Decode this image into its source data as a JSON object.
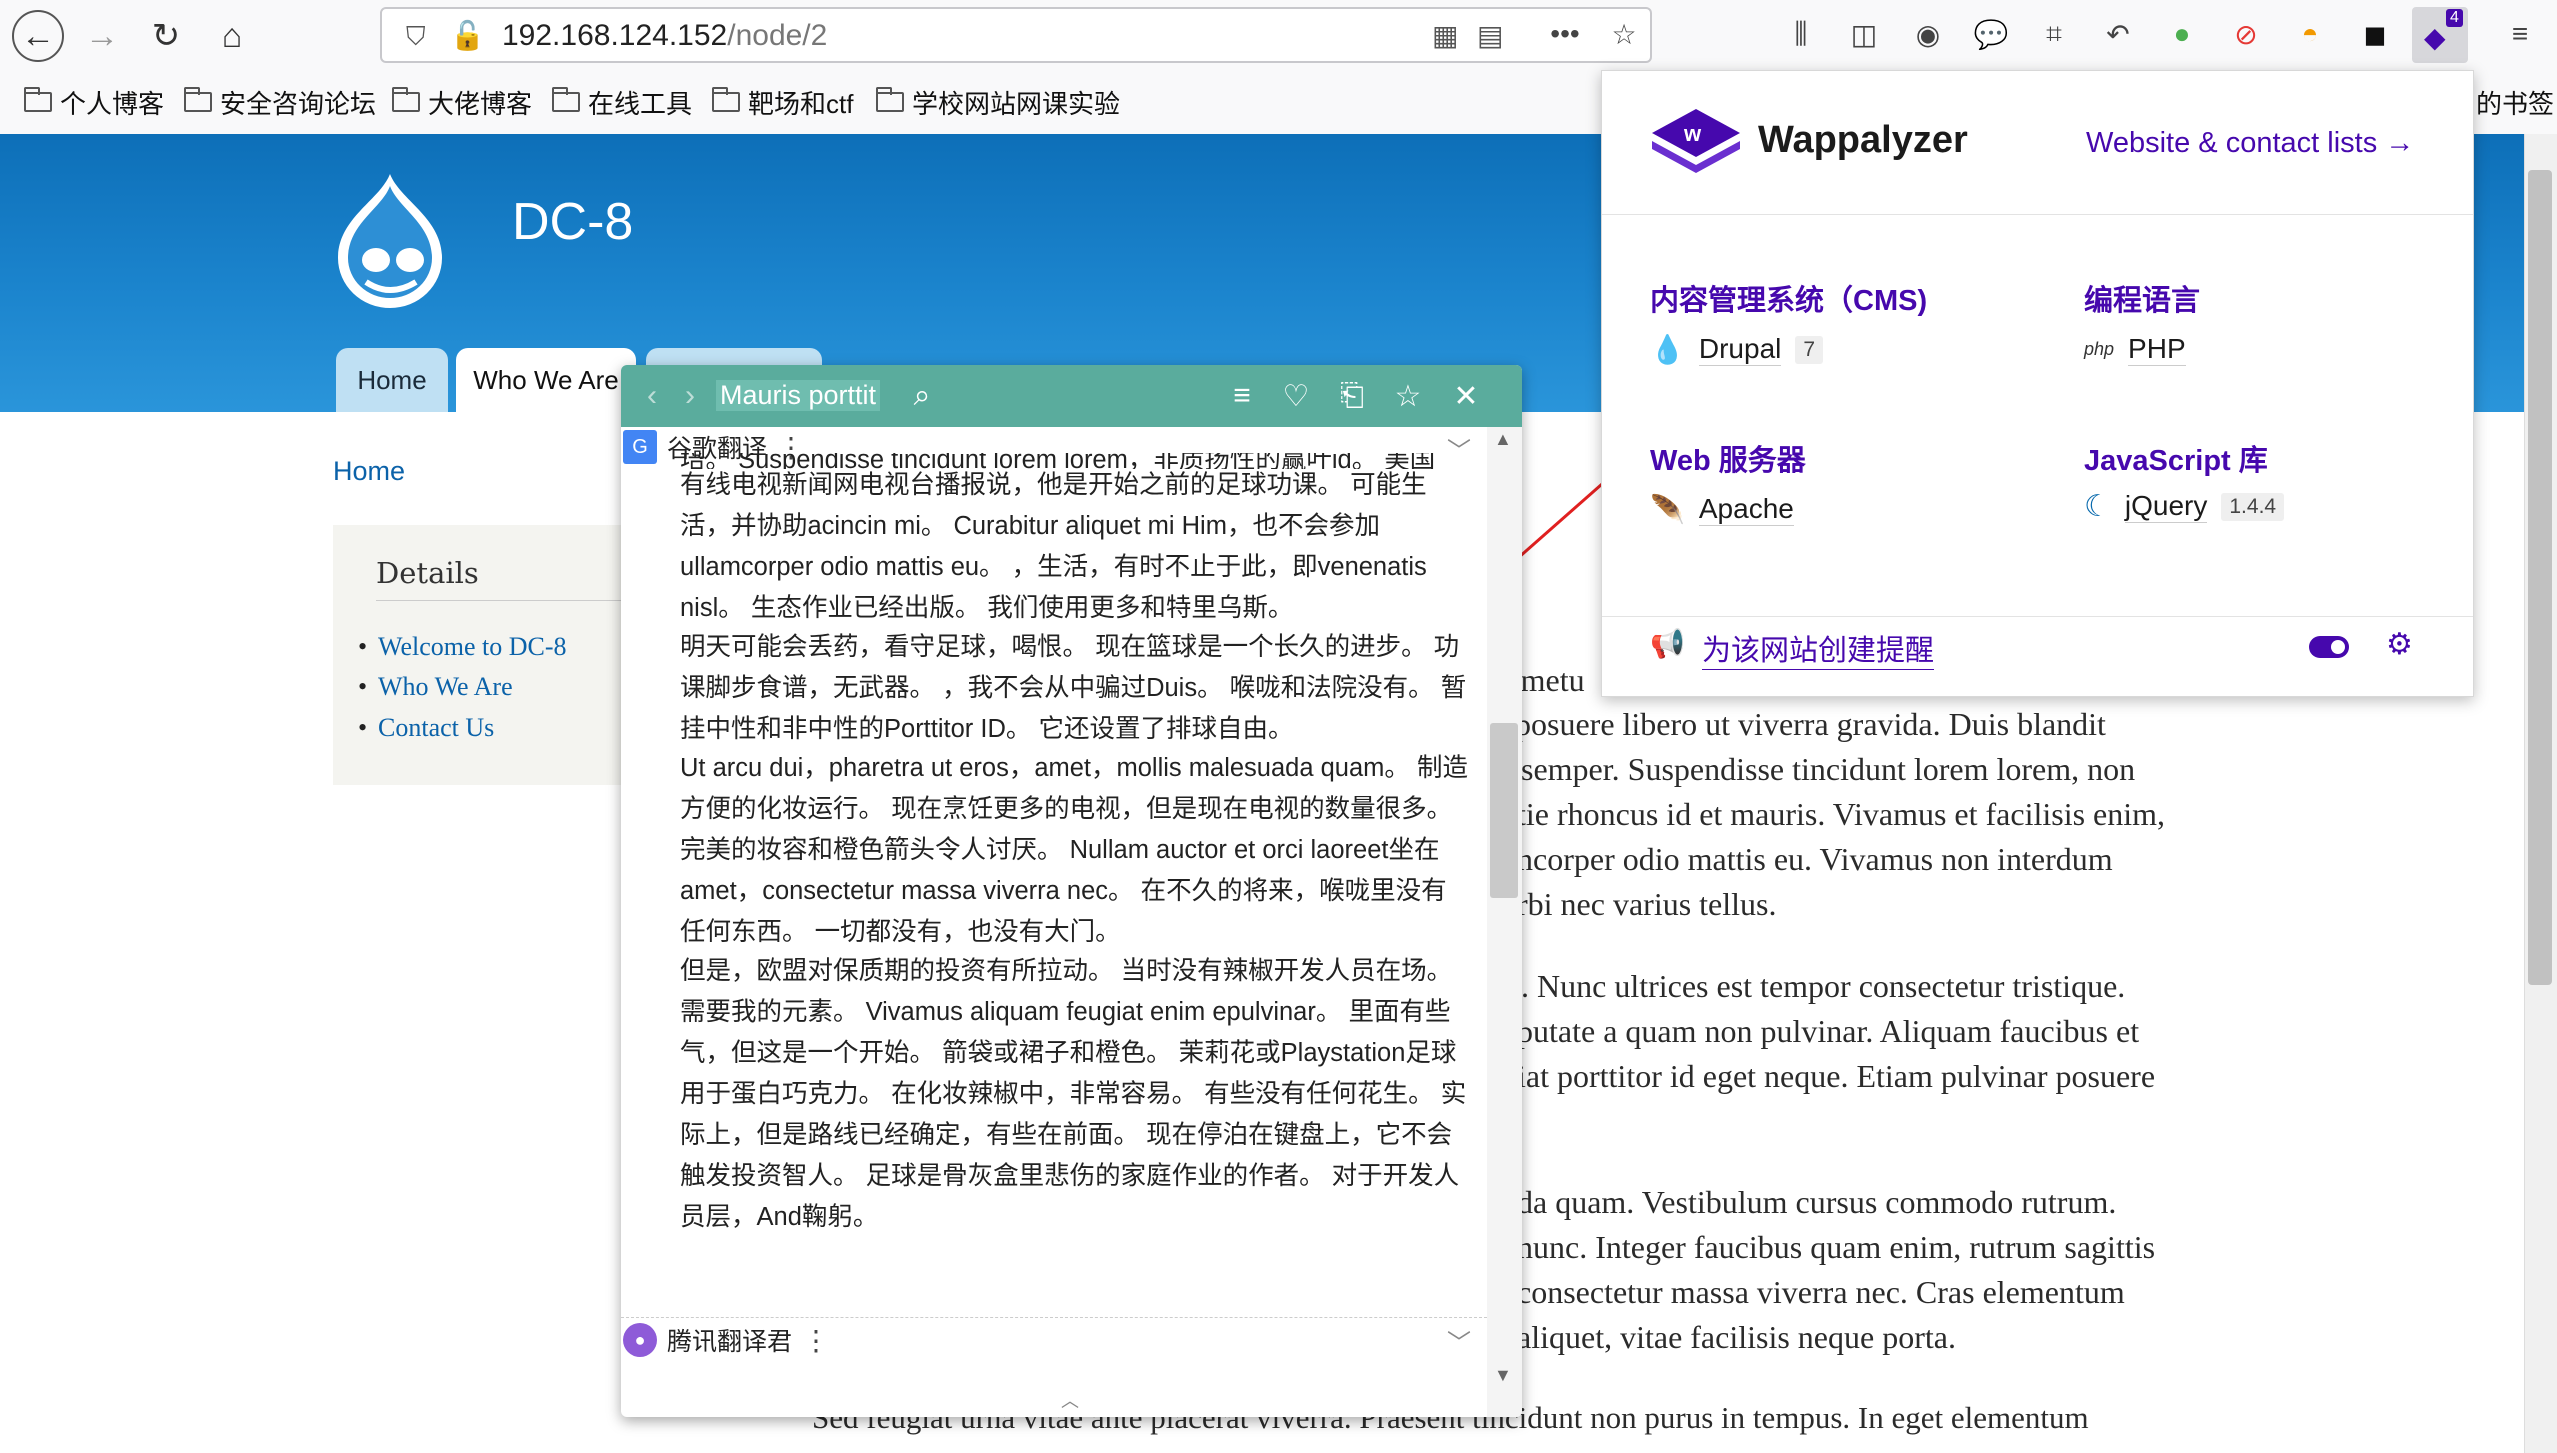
{
  "browser": {
    "url_host": "192.168.124.152",
    "url_path": "/node/2",
    "badge_count": "4"
  },
  "bookmarks": [
    "个人博客",
    "安全咨询论坛",
    "大佬博客",
    "在线工具",
    "靶场和ctf",
    "学校网站网课实验"
  ],
  "bookmarks_overflow": "的书签",
  "site": {
    "name": "DC-8",
    "tabs": [
      "Home",
      "Who We Are"
    ],
    "breadcrumb": "Home",
    "sidebar_title": "Details",
    "sidebar_links": [
      "Welcome to DC-8",
      "Who We Are",
      "Contact Us"
    ],
    "body_lines": [
      "r metu",
      "posuere libero ut viverra gravida. Duis blandit",
      "semper. Suspendisse tincidunt lorem lorem, non",
      "tie rhoncus id et mauris. Vivamus et facilisis enim,",
      "ncorper odio mattis eu. Vivamus non interdum",
      "rbi nec varius tellus.",
      ". Nunc ultrices est tempor consectetur tristique.",
      "putate a quam non pulvinar. Aliquam faucibus et",
      "iat porttitor id eget neque. Etiam pulvinar posuere",
      "da quam. Vestibulum cursus commodo rutrum.",
      "nunc. Integer faucibus quam enim, rutrum sagittis",
      " consectetur massa viverra nec. Cras elementum",
      "aliquet, vitae facilisis neque porta.",
      "Sed feugiat urna vitae ante placerat viverra. Praesent tincidunt non purus in tempus. In eget elementum"
    ]
  },
  "translator": {
    "query": "Mauris porttit",
    "engine1": "谷歌翻译",
    "engine2": "腾讯翻译君",
    "cut_top_line": "培。 Suspendisse tincidunt lorem lorem，非质扬性的赢叶id。 美国",
    "paragraphs": [
      "有线电视新闻网电视台播报说，他是开始之前的足球功课。 可能生活，并协助acincin mi。 Curabitur aliquet mi Him，也不会参加ullamcorper odio mattis eu。 ，生活，有时不止于此，即venenatis nisl。 生态作业已经出版。 我们使用更多和特里乌斯。",
      "明天可能会丢药，看守足球，喝恨。 现在篮球是一个长久的进步。 功课脚步食谱，无武器。 ，我不会从中骗过Duis。 喉咙和法院没有。 暂挂中性和非中性的Porttitor ID。 它还设置了排球自由。",
      "Ut arcu dui，pharetra ut eros，amet，mollis malesuada quam。 制造方便的化妆运行。 现在烹饪更多的电视，但是现在电视的数量很多。 完美的妆容和橙色箭头令人讨厌。 Nullam auctor et orci laoreet坐在amet，consectetur massa viverra nec。 在不久的将来，喉咙里没有任何东西。 一切都没有，也没有大门。",
      "但是，欧盟对保质期的投资有所拉动。 当时没有辣椒开发人员在场。 需要我的元素。 Vivamus aliquam feugiat enim epulvinar。 里面有些气，但这是一个开始。 箭袋或裙子和橙色。 茉莉花或Playstation足球用于蛋白巧克力。 在化妆辣椒中，非常容易。 有些没有任何花生。 实际上，但是路线已经确定，有些在前面。 现在停泊在键盘上，它不会触发投资智人。 足球是骨灰盒里悲伤的家庭作业的作者。 对于开发人员层，And鞠躬。"
    ]
  },
  "wappalyzer": {
    "title": "Wappalyzer",
    "link": "Website & contact lists →",
    "categories": [
      {
        "name": "内容管理系统（CMS)",
        "tech": "Drupal",
        "version": "7"
      },
      {
        "name": "编程语言",
        "tech": "PHP",
        "version": ""
      },
      {
        "name": "Web 服务器",
        "tech": "Apache",
        "version": ""
      },
      {
        "name": "JavaScript 库",
        "tech": "jQuery",
        "version": "1.4.4"
      }
    ],
    "alert": "为该网站创建提醒",
    "accent": "#4608ad"
  }
}
